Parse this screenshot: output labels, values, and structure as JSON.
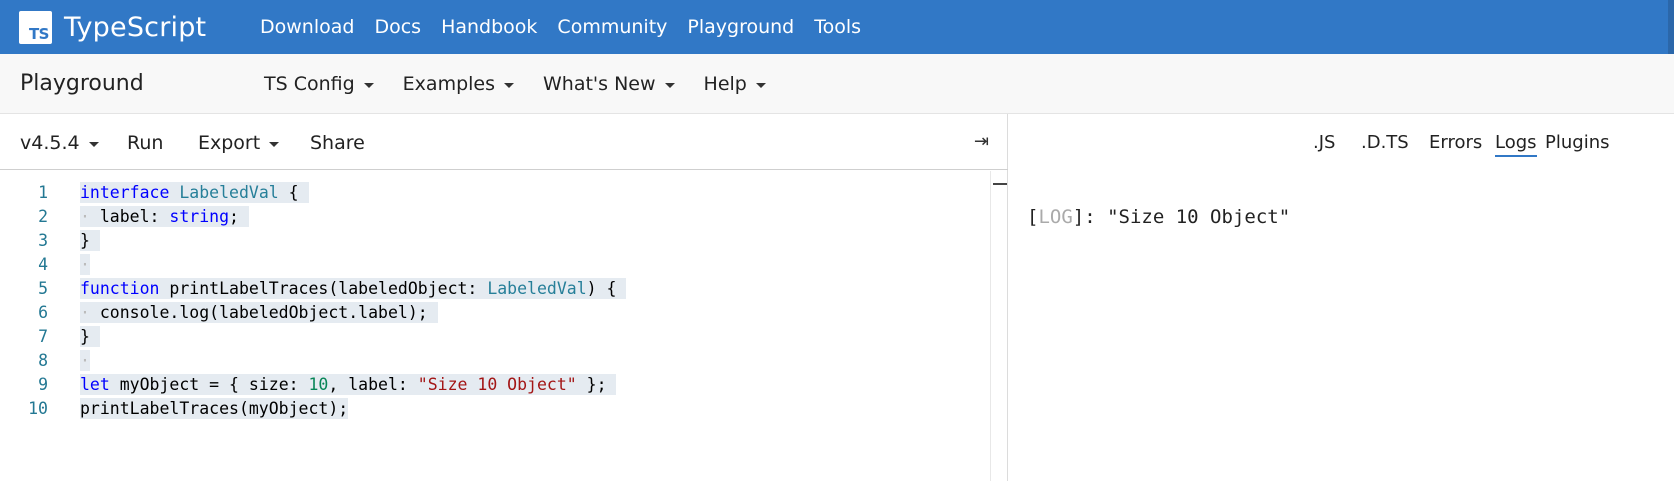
{
  "topnav": {
    "logo_text": "TS",
    "brand": "TypeScript",
    "links": [
      "Download",
      "Docs",
      "Handbook",
      "Community",
      "Playground",
      "Tools"
    ]
  },
  "subnav": {
    "title": "Playground",
    "menus": [
      "TS Config",
      "Examples",
      "What's New",
      "Help"
    ]
  },
  "editor": {
    "toolbar": {
      "version": "v4.5.4",
      "run": "Run",
      "export": "Export",
      "share": "Share",
      "collapse_icon": "⇥"
    },
    "lines": [
      {
        "n": "1"
      },
      {
        "n": "2"
      },
      {
        "n": "3"
      },
      {
        "n": "4"
      },
      {
        "n": "5"
      },
      {
        "n": "6"
      },
      {
        "n": "7"
      },
      {
        "n": "8"
      },
      {
        "n": "9"
      },
      {
        "n": "10"
      }
    ]
  },
  "output": {
    "tabs": [
      ".JS",
      ".D.TS",
      "Errors",
      "Logs",
      "Plugins"
    ],
    "active_tab": "Logs",
    "log_open": "[",
    "log_tag": "LOG",
    "log_close": "]: ",
    "log_message": "\"Size 10 Object\""
  },
  "colors": {
    "brand_blue": "#3178c6",
    "line_number": "#237893",
    "selection": "#e5ebf1"
  }
}
